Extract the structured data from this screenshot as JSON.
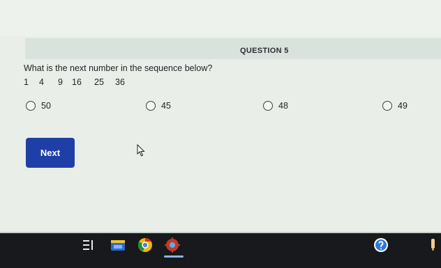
{
  "question": {
    "number_label": "QUESTION 5",
    "prompt": "What is the next number in the sequence below?",
    "sequence": [
      "1",
      "4",
      "9",
      "16",
      "25",
      "36"
    ]
  },
  "options": [
    {
      "label": "50"
    },
    {
      "label": "45"
    },
    {
      "label": "48"
    },
    {
      "label": "49"
    }
  ],
  "actions": {
    "next_label": "Next"
  },
  "taskbar": {
    "icons": [
      "launcher-icon",
      "files-icon",
      "chrome-icon",
      "settings-icon",
      "help-icon",
      "status-icon"
    ]
  }
}
